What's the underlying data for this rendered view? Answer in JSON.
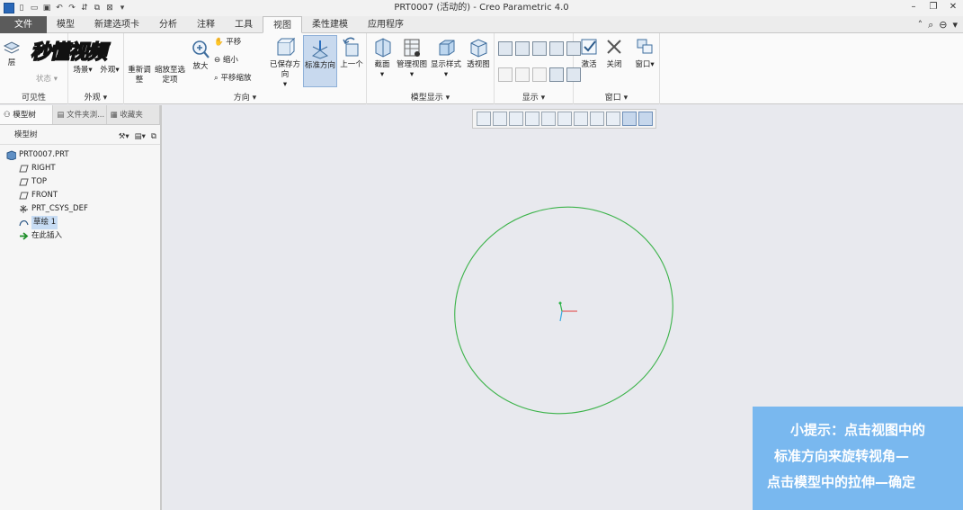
{
  "window": {
    "title": "PRT0007 (活动的) - Creo Parametric 4.0"
  },
  "tabs": [
    {
      "label": "文件"
    },
    {
      "label": "模型"
    },
    {
      "label": "新建选项卡"
    },
    {
      "label": "分析"
    },
    {
      "label": "注释"
    },
    {
      "label": "工具"
    },
    {
      "label": "视图"
    },
    {
      "label": "柔性建模"
    },
    {
      "label": "应用程序"
    }
  ],
  "ribbon": {
    "visibility": {
      "layer": "层",
      "status": "状态",
      "group": "可见性"
    },
    "appearance": {
      "scene": "场景",
      "appearance": "外观",
      "group": "外观"
    },
    "orientation": {
      "refit": "重新调整",
      "zoom_selected": "缩放至选定项",
      "zoom_in": "放大",
      "pan": "平移",
      "zoom_out": "缩小",
      "pan_zoom": "平移缩放",
      "saved_orientations": "已保存方向",
      "standard_orientation": "标准方向",
      "previous": "上一个",
      "group": "方向"
    },
    "model_display": {
      "section": "截面",
      "manage_views": "管理视图",
      "display_style": "显示样式",
      "perspective": "透视图",
      "group": "模型显示"
    },
    "show": {
      "group": "显示"
    },
    "window": {
      "activate": "激活",
      "close": "关闭",
      "window": "窗口",
      "group": "窗口"
    }
  },
  "logo": {
    "text": "秒懂视频"
  },
  "panel": {
    "tabs": [
      "模型树",
      "文件夹浏...",
      "收藏夹"
    ],
    "tree_header": "模型树",
    "tree": [
      {
        "label": "PRT0007.PRT",
        "icon": "part-icon",
        "indent": 0
      },
      {
        "label": "RIGHT",
        "icon": "datum-plane-icon",
        "indent": 1
      },
      {
        "label": "TOP",
        "icon": "datum-plane-icon",
        "indent": 1
      },
      {
        "label": "FRONT",
        "icon": "datum-plane-icon",
        "indent": 1
      },
      {
        "label": "PRT_CSYS_DEF",
        "icon": "csys-icon",
        "indent": 1
      },
      {
        "label": "草绘 1",
        "icon": "sketch-icon",
        "indent": 1,
        "selected": true
      },
      {
        "label": "在此插入",
        "icon": "insert-arrow-icon",
        "indent": 1
      }
    ]
  },
  "tip": {
    "lines": [
      "小提示：点击视图中的",
      "标准方向来旋转视角—",
      "点击模型中的拉伸—确定"
    ]
  },
  "colors": {
    "sketch": "#3cb34a",
    "tip_bg": "#79b8ef",
    "file_tab": "#5b5b5b",
    "selected": "#c8d9ee"
  }
}
